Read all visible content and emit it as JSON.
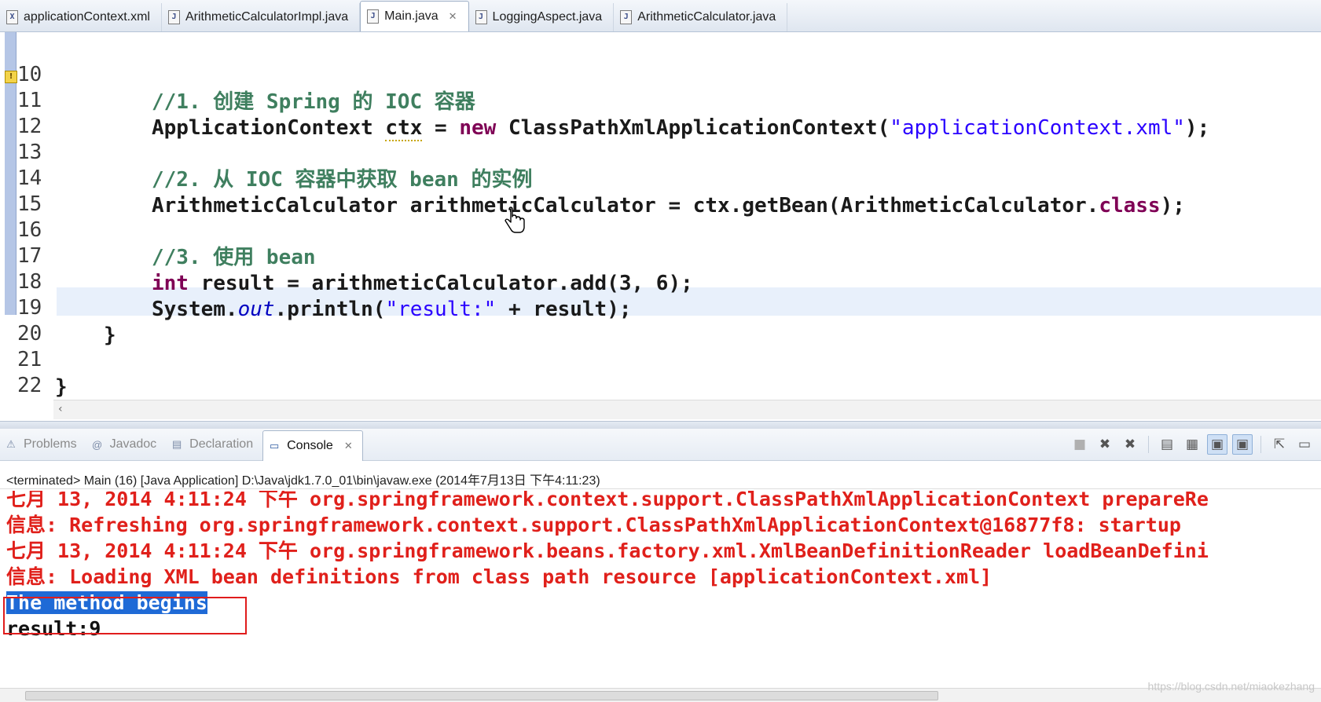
{
  "editor_tabs": [
    {
      "label": "applicationContext.xml",
      "icon": "xml-file-icon",
      "icon_glyph": "X"
    },
    {
      "label": "ArithmeticCalculatorImpl.java",
      "icon": "java-file-icon",
      "icon_glyph": "J"
    },
    {
      "label": "Main.java",
      "icon": "java-file-icon",
      "icon_glyph": "J",
      "active": true
    },
    {
      "label": "LoggingAspect.java",
      "icon": "java-file-icon",
      "icon_glyph": "J"
    },
    {
      "label": "ArithmeticCalculator.java",
      "icon": "java-file-icon",
      "icon_glyph": "J"
    }
  ],
  "editor": {
    "line_numbers": [
      "10",
      "11",
      "12",
      "13",
      "14",
      "15",
      "16",
      "17",
      "18",
      "19",
      "20",
      "21",
      "22"
    ],
    "lines": {
      "l10": "//1. 创建 Spring 的 IOC 容器",
      "l11_a": "ApplicationContext ",
      "l11_b": "ctx",
      "l11_c": " = ",
      "l11_kw": "new",
      "l11_d": " ClassPathXmlApplicationContext(",
      "l11_str": "\"applicationContext.xml\"",
      "l11_e": ");",
      "l13": "//2. 从 IOC 容器中获取 bean 的实例",
      "l14_a": "ArithmeticCalculator arithmeticCalculator = ctx.getBean(ArithmeticCalculator.",
      "l14_kw": "class",
      "l14_b": ");",
      "l16": "//3. 使用 bean",
      "l17_kw": "int",
      "l17_a": " result = arithmeticCalculator.add(3, 6);",
      "l18_a": "System.",
      "l18_it": "out",
      "l18_b": ".println(",
      "l18_str": "\"result:\"",
      "l18_c": " + result);",
      "l19": "}",
      "l21": "}"
    }
  },
  "views": {
    "tabs": [
      {
        "label": "Problems",
        "icon": "problems-icon",
        "glyph": "⚠"
      },
      {
        "label": "Javadoc",
        "icon": "javadoc-icon",
        "glyph": "@"
      },
      {
        "label": "Declaration",
        "icon": "declaration-icon",
        "glyph": "▤"
      },
      {
        "label": "Console",
        "icon": "console-icon",
        "glyph": "▭",
        "active": true
      }
    ]
  },
  "console": {
    "status": "<terminated> Main (16) [Java Application] D:\\Java\\jdk1.7.0_01\\bin\\javaw.exe (2014年7月13日 下午4:11:23)",
    "lines": [
      "七月 13, 2014 4:11:24 下午 org.springframework.context.support.ClassPathXmlApplicationContext prepareRe",
      "信息: Refreshing org.springframework.context.support.ClassPathXmlApplicationContext@16877f8: startup",
      "七月 13, 2014 4:11:24 下午 org.springframework.beans.factory.xml.XmlBeanDefinitionReader loadBeanDefini",
      "信息: Loading XML bean definitions from class path resource [applicationContext.xml]"
    ],
    "selected_output": "The method begins",
    "result_output": "result:9"
  },
  "watermark": "https://blog.csdn.net/miaokezhang",
  "colors": {
    "comment": "#3f7f5f",
    "keyword": "#7f0055",
    "string": "#2a00ff",
    "field": "#0000c0",
    "stderr": "#e0201b",
    "selection": "#1f6ad6",
    "highlight_box": "#e01c1c"
  }
}
